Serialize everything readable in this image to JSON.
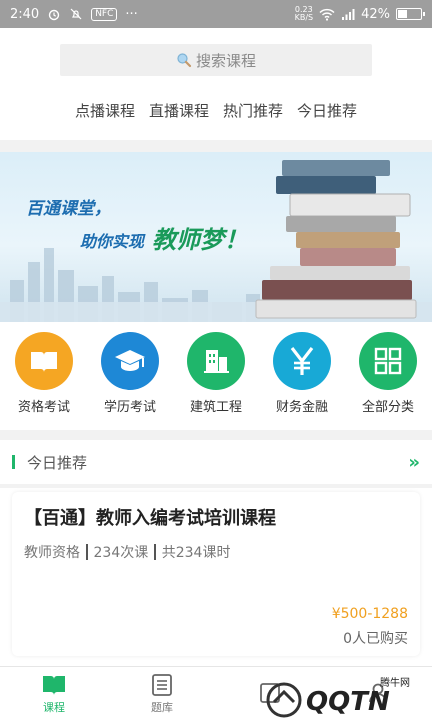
{
  "status_bar": {
    "time": "2:40",
    "nfc": "NFC",
    "more": "···",
    "net_speed_value": "0.23",
    "net_speed_unit": "KB/S",
    "battery_pct": "42%",
    "battery_level": 0.42
  },
  "search": {
    "placeholder": "搜索课程"
  },
  "nav_links": [
    "点播课程",
    "直播课程",
    "热门推荐",
    "今日推荐"
  ],
  "banner": {
    "line1": "百通课堂，",
    "line2": "助你实现",
    "line3": "教师梦！"
  },
  "categories": [
    {
      "label": "资格考试",
      "icon": "book-icon",
      "color": "#f5a623"
    },
    {
      "label": "学历考试",
      "icon": "graduation-cap-icon",
      "color": "#1e88d6"
    },
    {
      "label": "建筑工程",
      "icon": "building-icon",
      "color": "#1fb66b"
    },
    {
      "label": "财务金融",
      "icon": "yen-icon",
      "color": "#18a9d6"
    },
    {
      "label": "全部分类",
      "icon": "grid-icon",
      "color": "#1fb66b"
    }
  ],
  "today_section": {
    "title": "今日推荐",
    "more_icon": "double-chevron-right-icon"
  },
  "course": {
    "title": "【百通】教师入编考试培训课程",
    "category": "教师资格",
    "lessons": "234次课",
    "total": "共234课时",
    "price": "¥500-1288",
    "buyers": "0人已购买"
  },
  "bottom_nav": [
    {
      "label": "课程",
      "icon": "book-open-icon",
      "active": true
    },
    {
      "label": "题库",
      "icon": "list-icon",
      "active": false
    },
    {
      "label": "",
      "icon": "news-icon",
      "active": false
    },
    {
      "label": "",
      "icon": "user-icon",
      "active": false
    }
  ],
  "watermark": {
    "text": "腾牛网",
    "brand": "QQTN"
  }
}
